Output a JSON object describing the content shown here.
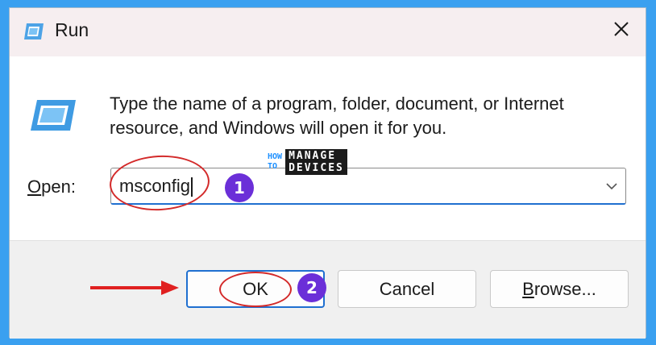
{
  "window": {
    "title": "Run",
    "title_icon": "run-app-icon",
    "close_icon": "close-icon"
  },
  "dialog": {
    "description": "Type the name of a program, folder, document, or Internet resource, and Windows will open it for you.",
    "open_label_accel": "O",
    "open_label_rest": "pen:",
    "open_value": "msconfig",
    "dropdown_icon": "chevron-down-icon"
  },
  "buttons": {
    "ok_label": "OK",
    "cancel_label": "Cancel",
    "browse_accel": "B",
    "browse_rest": "rowse..."
  },
  "annotations": {
    "step1": "1",
    "step2": "2"
  },
  "watermark": {
    "how": "HOW",
    "to": "TO",
    "manage": "MANAGE",
    "devices": "DEVICES"
  },
  "colors": {
    "background": "#3aa0f0",
    "accent": "#1f6fd0",
    "annotation_red": "#d32a2a",
    "badge_purple": "#6b2fd8"
  }
}
